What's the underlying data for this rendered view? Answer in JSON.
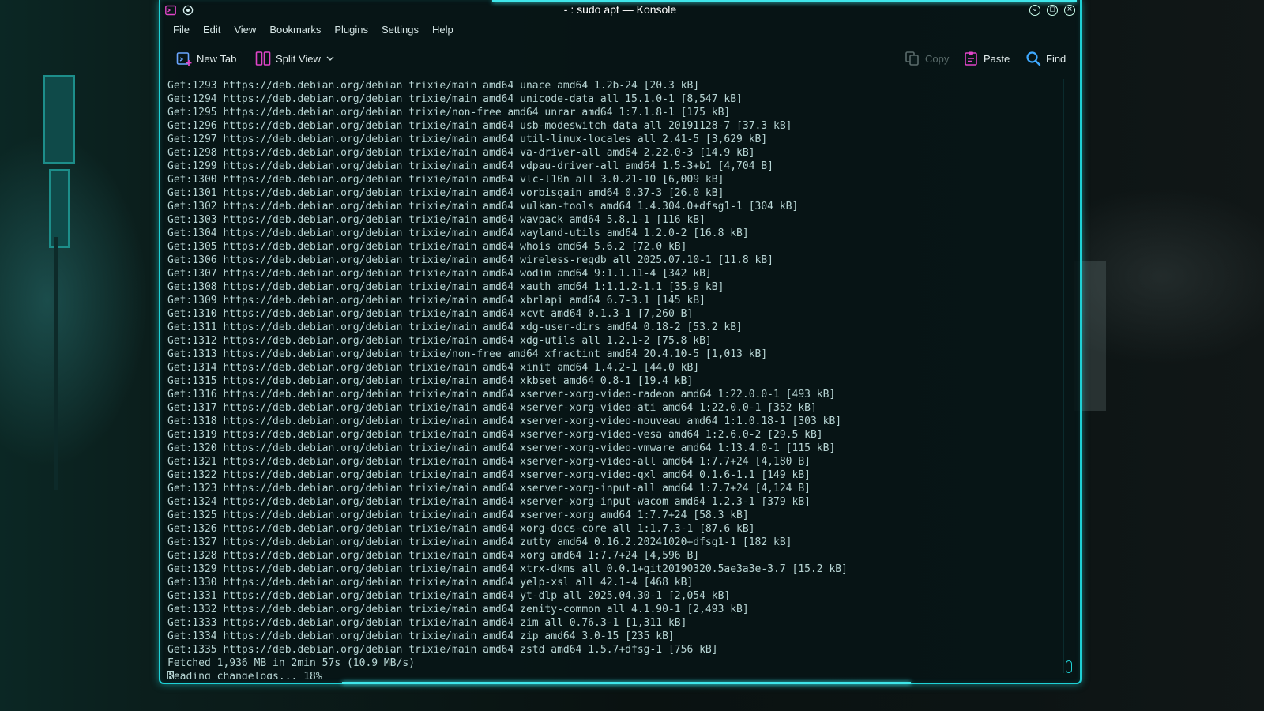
{
  "window": {
    "title": "- : sudo apt — Konsole"
  },
  "menu": [
    "File",
    "Edit",
    "View",
    "Bookmarks",
    "Plugins",
    "Settings",
    "Help"
  ],
  "toolbar": {
    "new_tab": "New Tab",
    "split_view": "Split View",
    "copy": "Copy",
    "paste": "Paste",
    "find": "Find"
  },
  "colors": {
    "accent": "#1fd1d6",
    "text": "#b7d5d4",
    "paste_icon": "#e045c8",
    "find_icon": "#3fa9ff"
  },
  "terminal": {
    "lines": [
      "Get:1293 https://deb.debian.org/debian trixie/main amd64 unace amd64 1.2b-24 [20.3 kB]",
      "Get:1294 https://deb.debian.org/debian trixie/main amd64 unicode-data all 15.1.0-1 [8,547 kB]",
      "Get:1295 https://deb.debian.org/debian trixie/non-free amd64 unrar amd64 1:7.1.8-1 [175 kB]",
      "Get:1296 https://deb.debian.org/debian trixie/main amd64 usb-modeswitch-data all 20191128-7 [37.3 kB]",
      "Get:1297 https://deb.debian.org/debian trixie/main amd64 util-linux-locales all 2.41-5 [3,629 kB]",
      "Get:1298 https://deb.debian.org/debian trixie/main amd64 va-driver-all amd64 2.22.0-3 [14.9 kB]",
      "Get:1299 https://deb.debian.org/debian trixie/main amd64 vdpau-driver-all amd64 1.5-3+b1 [4,704 B]",
      "Get:1300 https://deb.debian.org/debian trixie/main amd64 vlc-l10n all 3.0.21-10 [6,009 kB]",
      "Get:1301 https://deb.debian.org/debian trixie/main amd64 vorbisgain amd64 0.37-3 [26.0 kB]",
      "Get:1302 https://deb.debian.org/debian trixie/main amd64 vulkan-tools amd64 1.4.304.0+dfsg1-1 [304 kB]",
      "Get:1303 https://deb.debian.org/debian trixie/main amd64 wavpack amd64 5.8.1-1 [116 kB]",
      "Get:1304 https://deb.debian.org/debian trixie/main amd64 wayland-utils amd64 1.2.0-2 [16.8 kB]",
      "Get:1305 https://deb.debian.org/debian trixie/main amd64 whois amd64 5.6.2 [72.0 kB]",
      "Get:1306 https://deb.debian.org/debian trixie/main amd64 wireless-regdb all 2025.07.10-1 [11.8 kB]",
      "Get:1307 https://deb.debian.org/debian trixie/main amd64 wodim amd64 9:1.1.11-4 [342 kB]",
      "Get:1308 https://deb.debian.org/debian trixie/main amd64 xauth amd64 1:1.1.2-1.1 [35.9 kB]",
      "Get:1309 https://deb.debian.org/debian trixie/main amd64 xbrlapi amd64 6.7-3.1 [145 kB]",
      "Get:1310 https://deb.debian.org/debian trixie/main amd64 xcvt amd64 0.1.3-1 [7,260 B]",
      "Get:1311 https://deb.debian.org/debian trixie/main amd64 xdg-user-dirs amd64 0.18-2 [53.2 kB]",
      "Get:1312 https://deb.debian.org/debian trixie/main amd64 xdg-utils all 1.2.1-2 [75.8 kB]",
      "Get:1313 https://deb.debian.org/debian trixie/non-free amd64 xfractint amd64 20.4.10-5 [1,013 kB]",
      "Get:1314 https://deb.debian.org/debian trixie/main amd64 xinit amd64 1.4.2-1 [44.0 kB]",
      "Get:1315 https://deb.debian.org/debian trixie/main amd64 xkbset amd64 0.8-1 [19.4 kB]",
      "Get:1316 https://deb.debian.org/debian trixie/main amd64 xserver-xorg-video-radeon amd64 1:22.0.0-1 [493 kB]",
      "Get:1317 https://deb.debian.org/debian trixie/main amd64 xserver-xorg-video-ati amd64 1:22.0.0-1 [352 kB]",
      "Get:1318 https://deb.debian.org/debian trixie/main amd64 xserver-xorg-video-nouveau amd64 1:1.0.18-1 [303 kB]",
      "Get:1319 https://deb.debian.org/debian trixie/main amd64 xserver-xorg-video-vesa amd64 1:2.6.0-2 [29.5 kB]",
      "Get:1320 https://deb.debian.org/debian trixie/main amd64 xserver-xorg-video-vmware amd64 1:13.4.0-1 [115 kB]",
      "Get:1321 https://deb.debian.org/debian trixie/main amd64 xserver-xorg-video-all amd64 1:7.7+24 [4,180 B]",
      "Get:1322 https://deb.debian.org/debian trixie/main amd64 xserver-xorg-video-qxl amd64 0.1.6-1.1 [149 kB]",
      "Get:1323 https://deb.debian.org/debian trixie/main amd64 xserver-xorg-input-all amd64 1:7.7+24 [4,124 B]",
      "Get:1324 https://deb.debian.org/debian trixie/main amd64 xserver-xorg-input-wacom amd64 1.2.3-1 [379 kB]",
      "Get:1325 https://deb.debian.org/debian trixie/main amd64 xserver-xorg amd64 1:7.7+24 [58.3 kB]",
      "Get:1326 https://deb.debian.org/debian trixie/main amd64 xorg-docs-core all 1:1.7.3-1 [87.6 kB]",
      "Get:1327 https://deb.debian.org/debian trixie/main amd64 zutty amd64 0.16.2.20241020+dfsg1-1 [182 kB]",
      "Get:1328 https://deb.debian.org/debian trixie/main amd64 xorg amd64 1:7.7+24 [4,596 B]",
      "Get:1329 https://deb.debian.org/debian trixie/main amd64 xtrx-dkms all 0.0.1+git20190320.5ae3a3e-3.7 [15.2 kB]",
      "Get:1330 https://deb.debian.org/debian trixie/main amd64 yelp-xsl all 42.1-4 [468 kB]",
      "Get:1331 https://deb.debian.org/debian trixie/main amd64 yt-dlp all 2025.04.30-1 [2,054 kB]",
      "Get:1332 https://deb.debian.org/debian trixie/main amd64 zenity-common all 4.1.90-1 [2,493 kB]",
      "Get:1333 https://deb.debian.org/debian trixie/main amd64 zim all 0.76.3-1 [1,311 kB]",
      "Get:1334 https://deb.debian.org/debian trixie/main amd64 zip amd64 3.0-15 [235 kB]",
      "Get:1335 https://deb.debian.org/debian trixie/main amd64 zstd amd64 1.5.7+dfsg-1 [756 kB]",
      "Fetched 1,936 MB in 2min 57s (10.9 MB/s)"
    ],
    "prompt_cursor_char": "R",
    "prompt_rest": "eading changelogs... 18%"
  }
}
